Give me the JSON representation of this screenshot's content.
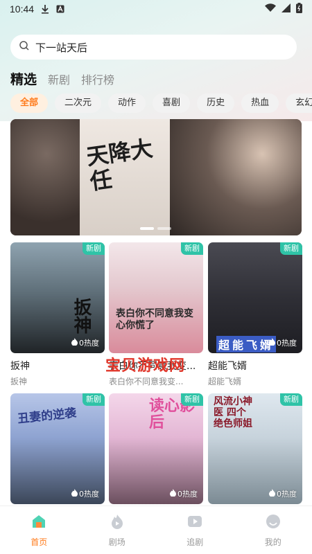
{
  "status_bar": {
    "time": "10:44"
  },
  "search": {
    "placeholder": "下一站天后"
  },
  "tabs": [
    {
      "label": "精选",
      "active": true
    },
    {
      "label": "新剧",
      "active": false
    },
    {
      "label": "排行榜",
      "active": false
    }
  ],
  "categories": [
    {
      "label": "全部",
      "active": true
    },
    {
      "label": "二次元",
      "active": false
    },
    {
      "label": "动作",
      "active": false
    },
    {
      "label": "喜剧",
      "active": false
    },
    {
      "label": "历史",
      "active": false
    },
    {
      "label": "热血",
      "active": false
    },
    {
      "label": "玄幻",
      "active": false
    }
  ],
  "banner": {
    "art_title": "天降大任",
    "slides": 2,
    "current_slide": 1
  },
  "grid": [
    {
      "title": "扳神",
      "subtitle": "扳神",
      "badge": "新剧",
      "heat": "0热度",
      "poster_text": "扳神"
    },
    {
      "title": "表白你不同意我变...",
      "subtitle": "表白你不同意我变...",
      "badge": "新剧",
      "heat": "0热度",
      "poster_text": "表白你不同意我变心你慌了"
    },
    {
      "title": "超能飞婿",
      "subtitle": "超能飞婿",
      "badge": "新剧",
      "heat": "0热度",
      "poster_text": "超能飞婿"
    },
    {
      "title": "",
      "subtitle": "",
      "badge": "新剧",
      "heat": "0热度",
      "poster_text": "丑妻的逆袭"
    },
    {
      "title": "",
      "subtitle": "",
      "badge": "新剧",
      "heat": "0热度",
      "poster_text": "读心影后"
    },
    {
      "title": "",
      "subtitle": "",
      "badge": "新剧",
      "heat": "0热度",
      "poster_text": "风流小神医 四个绝色师姐"
    }
  ],
  "watermark": "宝贝游戏网",
  "bottom_nav": [
    {
      "label": "首页",
      "icon": "home-icon",
      "active": true
    },
    {
      "label": "剧场",
      "icon": "theater-icon",
      "active": false
    },
    {
      "label": "追剧",
      "icon": "play-icon",
      "active": false
    },
    {
      "label": "我的",
      "icon": "profile-icon",
      "active": false
    }
  ],
  "colors": {
    "accent": "#ff7a1a",
    "badge": "#2fc3a7",
    "watermark": "#e0362a"
  }
}
